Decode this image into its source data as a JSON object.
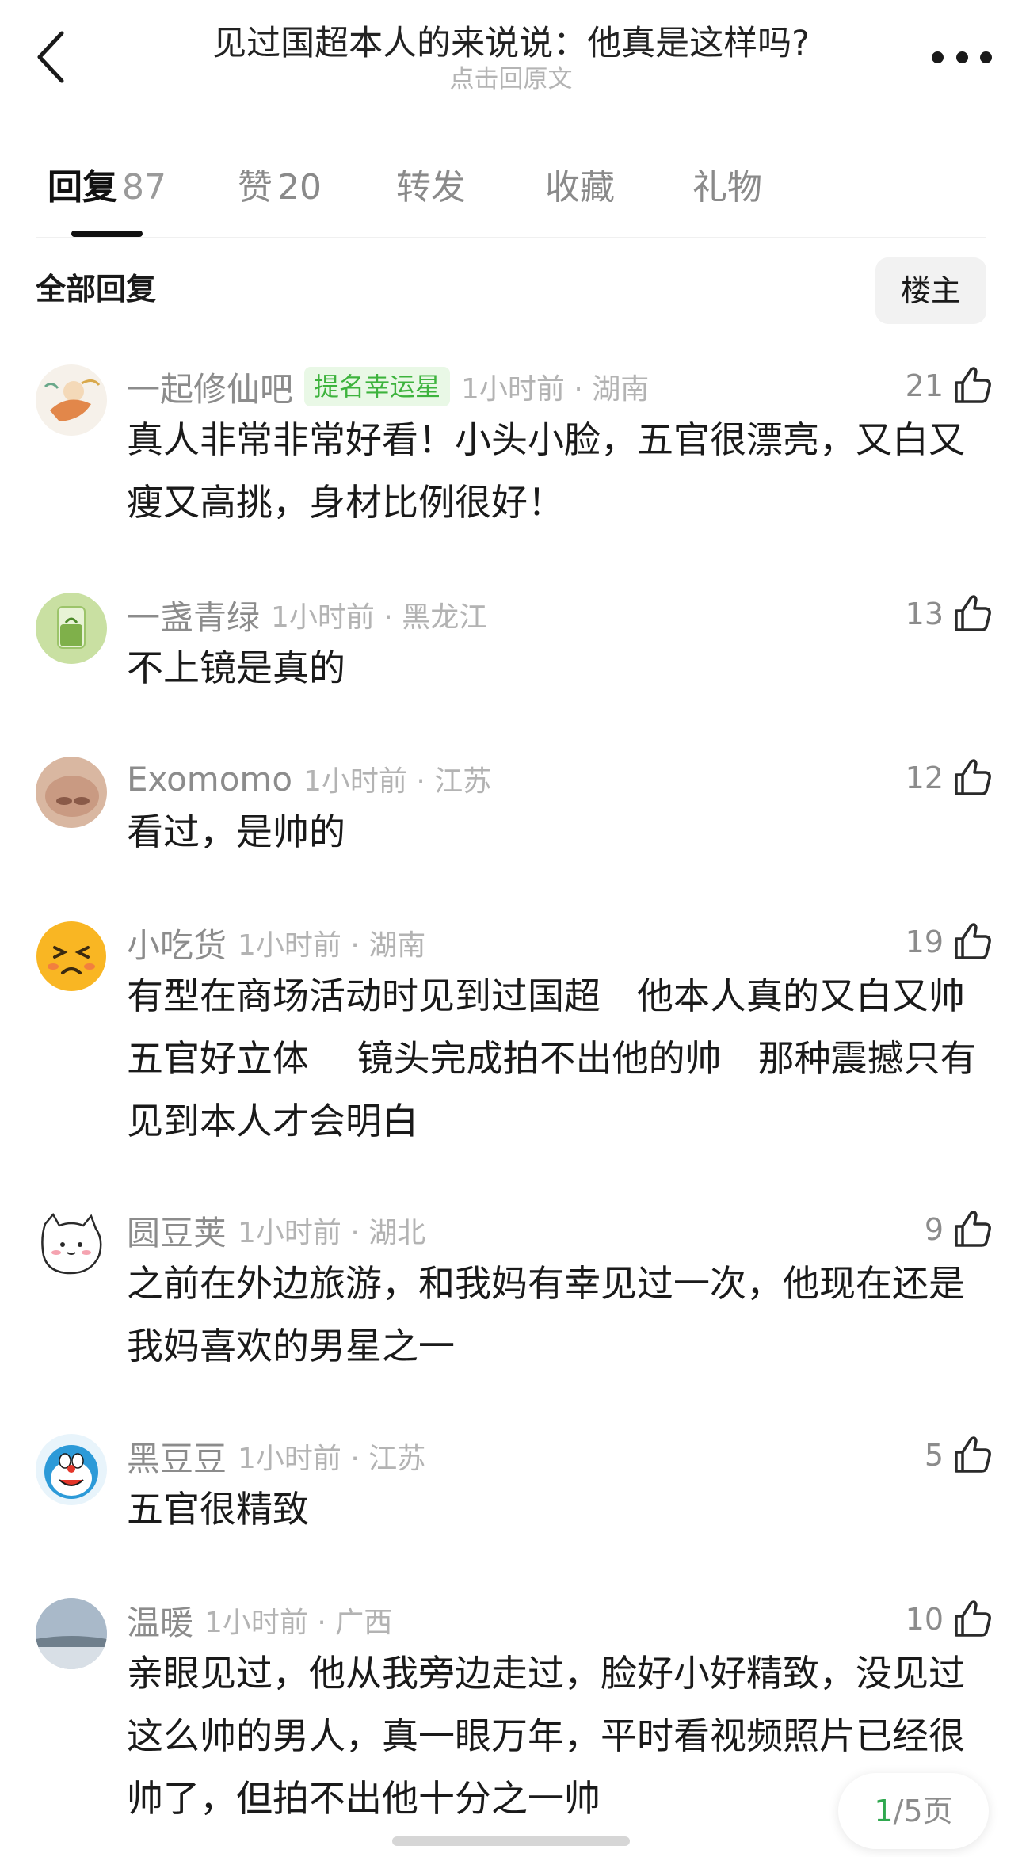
{
  "header": {
    "title": "见过国超本人的来说说：他真是这样吗?",
    "subtitle": "点击回原文"
  },
  "tabs": [
    {
      "label": "回复",
      "count": "87"
    },
    {
      "label": "赞",
      "count": "20"
    },
    {
      "label": "转发",
      "count": ""
    },
    {
      "label": "收藏",
      "count": ""
    },
    {
      "label": "礼物",
      "count": ""
    }
  ],
  "section": {
    "title": "全部回复",
    "owner_button": "楼主"
  },
  "comments": [
    {
      "user": "一起修仙吧",
      "badge": "提名幸运星",
      "time": "1小时前 · 湖南",
      "likes": "21",
      "text": "真人非常非常好看！小头小脸，五官很漂亮，又白又瘦又高挑，身材比例很好！"
    },
    {
      "user": "一盏青绿",
      "time": "1小时前 · 黑龙江",
      "likes": "13",
      "text": "不上镜是真的"
    },
    {
      "user": "Exomomo",
      "time": "1小时前 · 江苏",
      "likes": "12",
      "text": "看过，是帅的"
    },
    {
      "user": "小吃货",
      "time": "1小时前 · 湖南",
      "likes": "19",
      "text": "有型在商场活动时见到过国超　他本人真的又白又帅五官好立体　 镜头完成拍不出他的帅　那种震撼只有见到本人才会明白"
    },
    {
      "user": "圆豆荚",
      "time": "1小时前 · 湖北",
      "likes": "9",
      "text": "之前在外边旅游，和我妈有幸见过一次，他现在还是我妈喜欢的男星之一"
    },
    {
      "user": "黑豆豆",
      "time": "1小时前 · 江苏",
      "likes": "5",
      "text": "五官很精致"
    },
    {
      "user": "温暖",
      "time": "1小时前 · 广西",
      "likes": "10",
      "text": "亲眼见过，他从我旁边走过，脸好小好精致，没见过这么帅的男人，真一眼万年，平时看视频照片已经很帅了，但拍不出他十分之一帅"
    }
  ],
  "pager": {
    "current": "1",
    "total": "/5页"
  },
  "colors": {
    "accent_green": "#2fa84f",
    "badge_green": "#3db33d",
    "meta_gray": "#8c8c8c"
  }
}
